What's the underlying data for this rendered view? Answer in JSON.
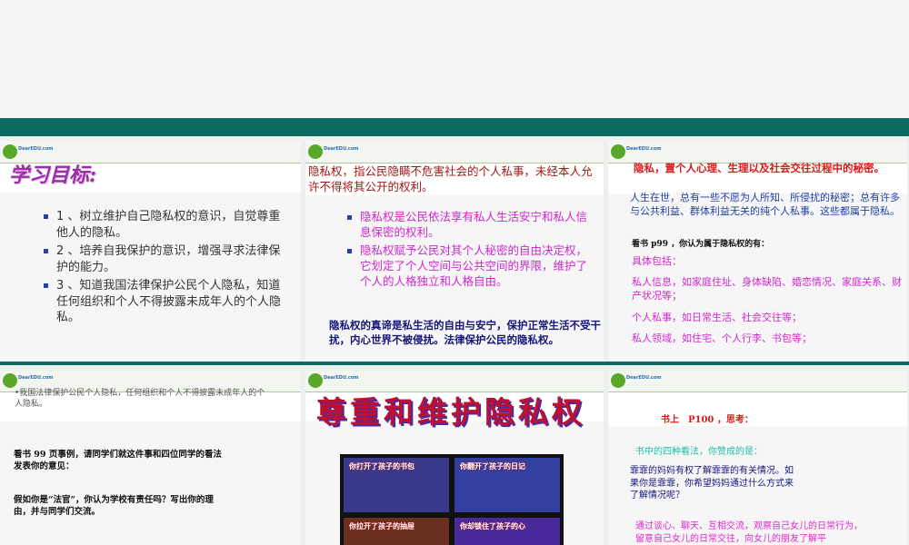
{
  "logo_text": "DearEDU.com",
  "slides": [
    {
      "title": "学习目标:",
      "items": [
        "1 、树立维护自己隐私权的意识，自觉尊重他人的隐私。",
        "2 、培养自我保护的意识，增强寻求法律保护的能力。",
        "3 、知道我国法律保护公民个人隐私，知道任何组织和个人不得披露未成年人的个人隐私。"
      ]
    },
    {
      "definition": "隐私权，指公民隐瞒不危害社会的个人私事，未经本人允许不得将其公开的权利。",
      "items": [
        "隐私权是公民依法享有私人生活安宁和私人信息保密的权利。",
        "隐私权赋予公民对其个人秘密的自由决定权，它划定了个人空间与公共空间的界限，维护了个人的人格独立和人格自由。"
      ],
      "summary": "隐私权的真谛是私生活的自由与安宁，保护正常生活不受干扰，内心世界不被侵扰。法律保护公民的隐私权。"
    },
    {
      "definition": "隐私，置个人心理、生理以及社会交往过程中的秘密。",
      "intro": "人生在世，总有一些不愿为人所知、所侵扰的秘密；总有许多与公共利益、群体利益无关的纯个人私事。这些都属于隐私。",
      "question": "看书 p99 ，你认为属于隐私权的有：",
      "label": "具体包括：",
      "items": [
        "私人信息，如家庭住址、身体缺陷、婚恋情况、家庭关系、财产状况等；",
        "个人私事，如日常生活、社会交往等；",
        "私人领域，如住宅、个人行李、书包等；"
      ]
    },
    {
      "note": "•我国法律保护公民个人隐私，任何组织和个人不得披露未成年人的个人隐私。",
      "q1": "看书 99 页事例，请同学们就这件事和四位同学的看法发表你的意见：",
      "q2": "假如你是“法官”，你认为学校有责任吗？写出你的理由，并与同学们交流。"
    },
    {
      "title": "尊重和维护隐私权",
      "captions": [
        "你打开了孩子的书包",
        "你翻开了孩子的日记",
        "你拉开了孩子的抽屉",
        "你却锁住了孩子的心"
      ]
    },
    {
      "prompt": "书上　P100 ，思考：",
      "q1": "书中的四种看法，你赞成的是：",
      "q2": "霏霏的妈妈有权了解霏霏的有关情况。如果你是霏霏，你希望妈妈通过什么方式来了解情况呢？",
      "answer": "通过谈心、聊天、互相交流，观察自己女儿的日常行为，留意自己女儿的日常交往，向女儿的朋友了解平"
    }
  ]
}
